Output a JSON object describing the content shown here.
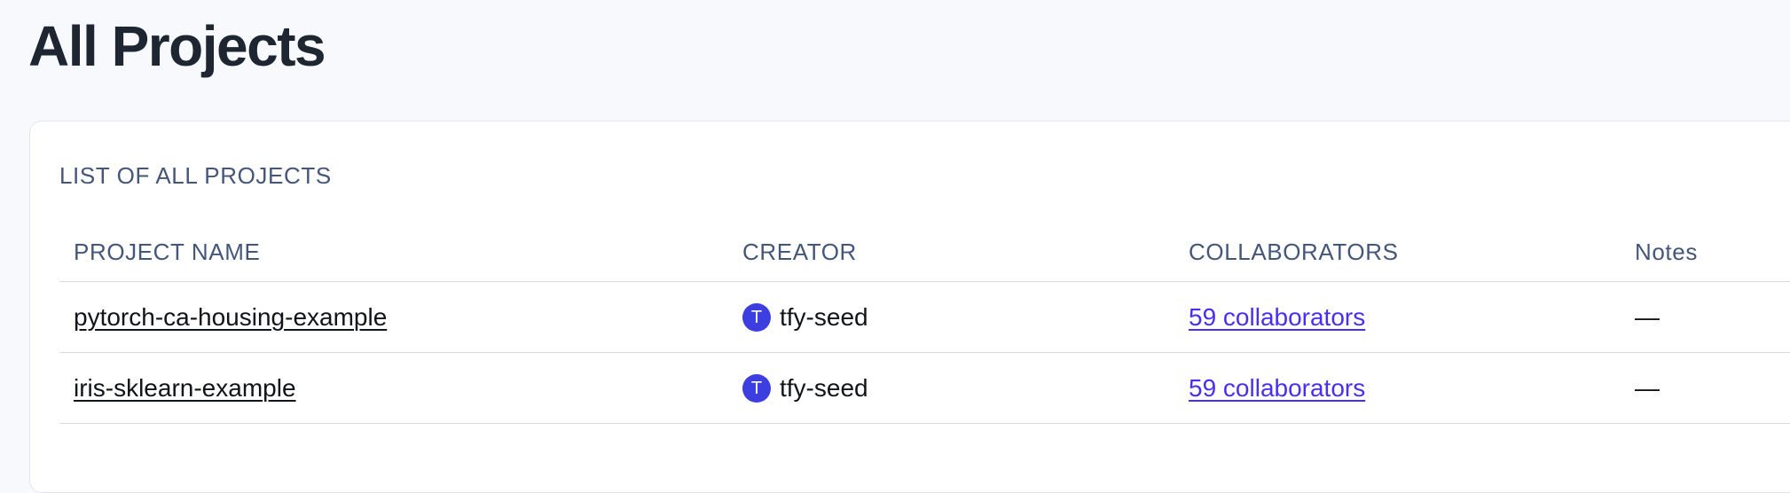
{
  "page": {
    "title": "All Projects"
  },
  "card": {
    "heading": "LIST OF ALL PROJECTS"
  },
  "table": {
    "columns": [
      "PROJECT NAME",
      "CREATOR",
      "COLLABORATORS",
      "Notes"
    ],
    "rows": [
      {
        "project_name": "pytorch-ca-housing-example",
        "creator_initial": "T",
        "creator": "tfy-seed",
        "collaborators": "59 collaborators",
        "notes": "—"
      },
      {
        "project_name": "iris-sklearn-example",
        "creator_initial": "T",
        "creator": "tfy-seed",
        "collaborators": "59 collaborators",
        "notes": "—"
      }
    ]
  },
  "colors": {
    "avatar": "#3d3ee0",
    "link_accent": "#4a2ff0",
    "muted_text": "#44577a",
    "title_text": "#1e2632"
  }
}
